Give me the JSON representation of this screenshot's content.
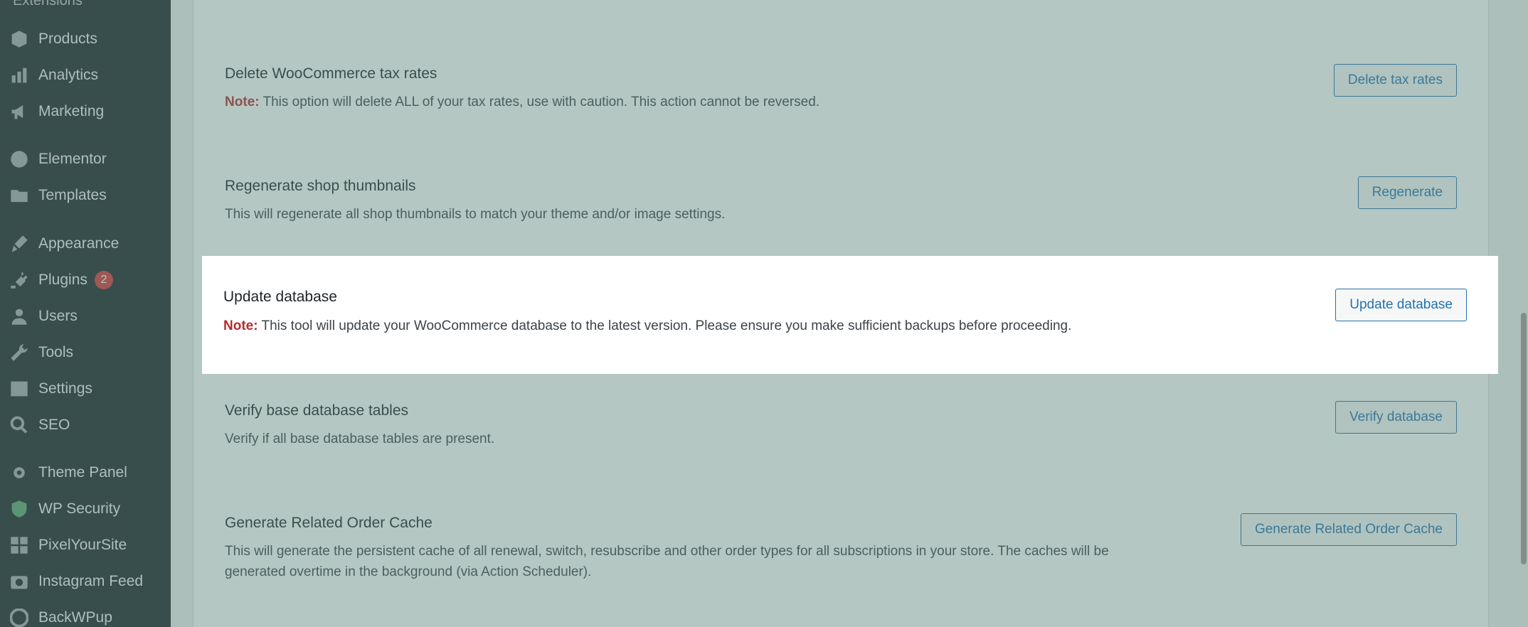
{
  "sidebar": {
    "cut_label": "Extensions",
    "items": [
      {
        "label": "Products",
        "icon": "box-icon"
      },
      {
        "label": "Analytics",
        "icon": "bar-chart-icon"
      },
      {
        "label": "Marketing",
        "icon": "megaphone-icon"
      },
      {
        "label": "Elementor",
        "icon": "elementor-icon"
      },
      {
        "label": "Templates",
        "icon": "folder-icon"
      },
      {
        "label": "Appearance",
        "icon": "paintbrush-icon"
      },
      {
        "label": "Plugins",
        "icon": "plug-icon",
        "badge": "2"
      },
      {
        "label": "Users",
        "icon": "user-icon"
      },
      {
        "label": "Tools",
        "icon": "wrench-icon"
      },
      {
        "label": "Settings",
        "icon": "settings-icon"
      },
      {
        "label": "SEO",
        "icon": "search-icon"
      },
      {
        "label": "Theme Panel",
        "icon": "gear-icon"
      },
      {
        "label": "WP Security",
        "icon": "shield-icon"
      },
      {
        "label": "PixelYourSite",
        "icon": "grid-icon"
      },
      {
        "label": "Instagram Feed",
        "icon": "camera-icon"
      },
      {
        "label": "BackWPup",
        "icon": "backup-icon"
      }
    ]
  },
  "tools": [
    {
      "title": "Delete WooCommerce tax rates",
      "note_label": "Note:",
      "description": " This option will delete ALL of your tax rates, use with caution. This action cannot be reversed.",
      "button": "Delete tax rates"
    },
    {
      "title": "Regenerate shop thumbnails",
      "description": "This will regenerate all shop thumbnails to match your theme and/or image settings.",
      "button": "Regenerate"
    },
    {
      "title": "Update database",
      "note_label": "Note:",
      "description": " This tool will update your WooCommerce database to the latest version. Please ensure you make sufficient backups before proceeding.",
      "button": "Update database"
    },
    {
      "title": "Verify base database tables",
      "description": "Verify if all base database tables are present.",
      "button": "Verify database"
    },
    {
      "title": "Generate Related Order Cache",
      "description": "This will generate the persistent cache of all renewal, switch, resubscribe and other order types for all subscriptions in your store. The caches will be generated overtime in the background (via Action Scheduler).",
      "button": "Generate Related Order Cache"
    }
  ],
  "colors": {
    "overlay": "#5c827a",
    "note": "#b32d2e",
    "button": "#2271b1"
  }
}
